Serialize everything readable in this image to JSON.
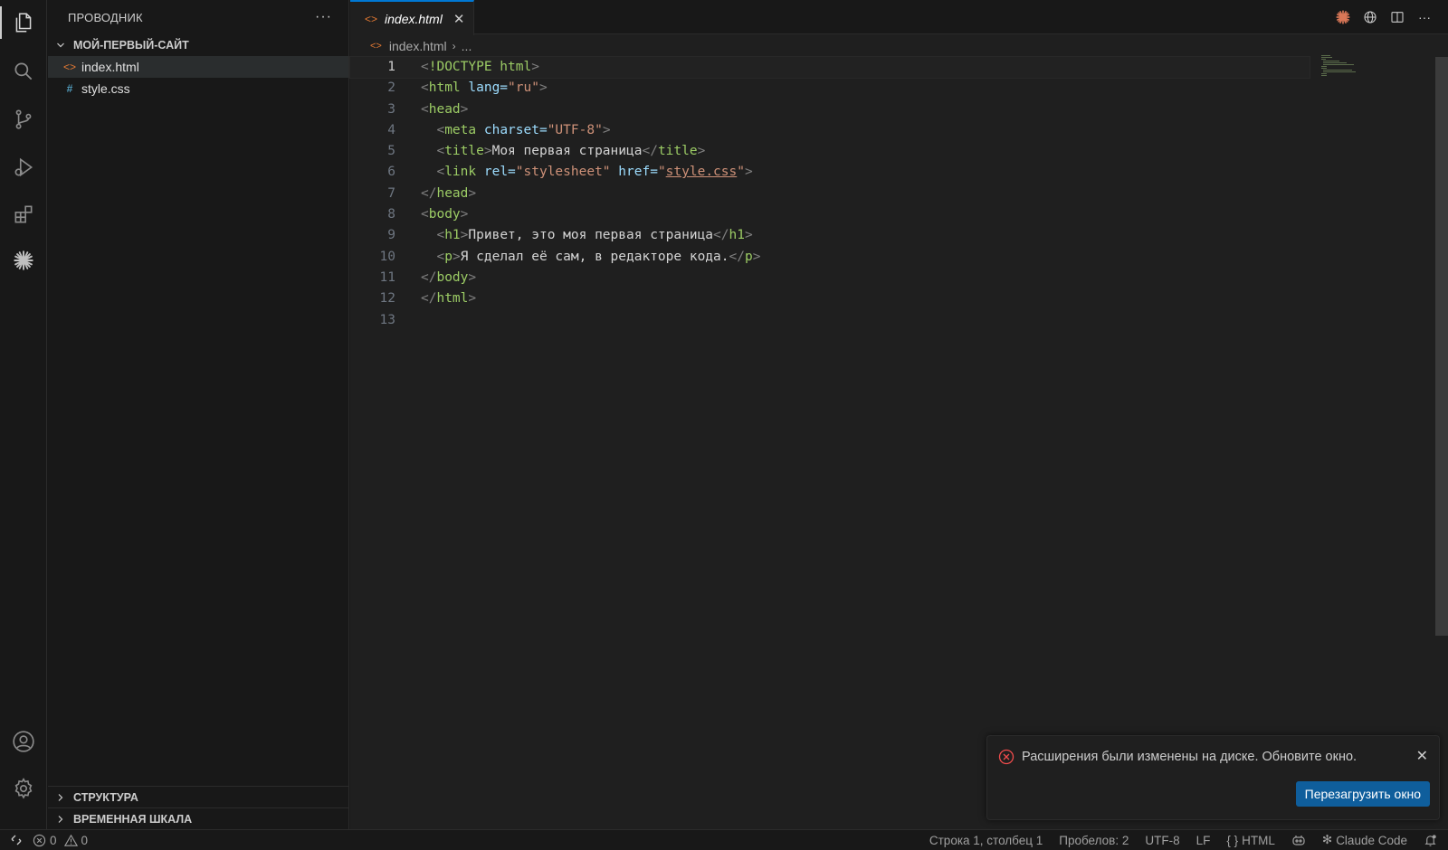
{
  "sidebar": {
    "title": "ПРОВОДНИК",
    "more": "···",
    "folder": "МОЙ-ПЕРВЫЙ-САЙТ",
    "files": [
      {
        "name": "index.html",
        "icon": "html-file-icon"
      },
      {
        "name": "style.css",
        "icon": "css-file-icon"
      }
    ],
    "sections": [
      "СТРУКТУРА",
      "ВРЕМЕННАЯ ШКАЛА"
    ]
  },
  "editor": {
    "tab_label": "index.html",
    "breadcrumb_file": "index.html",
    "breadcrumb_more": "...",
    "line_numbers": [
      "1",
      "2",
      "3",
      "4",
      "5",
      "6",
      "7",
      "8",
      "9",
      "10",
      "11",
      "12",
      "13"
    ],
    "code": {
      "doctype": "!DOCTYPE html",
      "html_open": "html",
      "html_lang_attr": "lang=",
      "html_lang_val": "\"ru\"",
      "head_open": "head",
      "meta": "meta",
      "meta_attr": "charset=",
      "meta_val": "\"UTF-8\"",
      "title_tag": "title",
      "title_text": "Моя первая страница",
      "link": "link",
      "link_rel_attr": "rel=",
      "link_rel_val": "\"stylesheet\"",
      "link_href_attr": "href=",
      "link_href_q1": "\"",
      "link_href_val": "style.css",
      "link_href_q2": "\"",
      "head_close": "head",
      "body_open": "body",
      "h1": "h1",
      "h1_text": "Привет, это моя первая страница",
      "p": "p",
      "p_text": "Я сделал её сам, в редакторе кода.",
      "body_close": "body",
      "html_close": "html"
    }
  },
  "notification": {
    "message": "Расширения были изменены на диске. Обновите окно.",
    "button": "Перезагрузить окно",
    "close": "✕"
  },
  "statusbar": {
    "errors": "0",
    "warnings": "0",
    "position": "Строка 1, столбец 1",
    "spaces": "Пробелов: 2",
    "encoding": "UTF-8",
    "eol": "LF",
    "language": "HTML",
    "claude": "Claude Code"
  },
  "colors": {
    "accent": "#0078d4",
    "claude_orange": "#d97757",
    "button_blue": "#0f5e9c",
    "error_red": "#f14c4c"
  }
}
